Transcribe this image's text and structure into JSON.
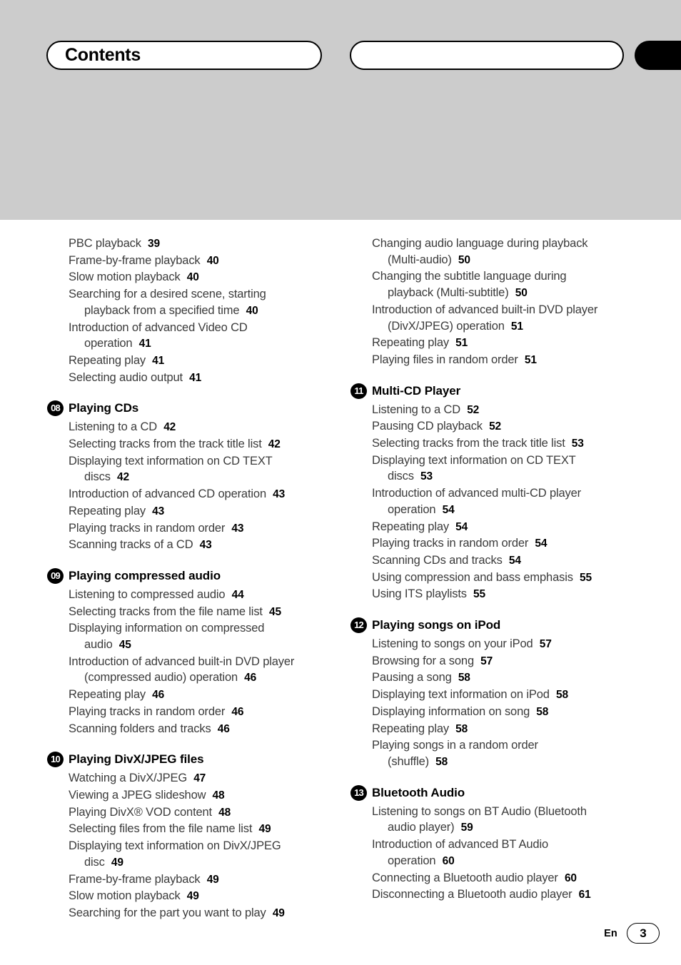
{
  "header": {
    "title": "Contents",
    "blank_pill_label": "",
    "black_tab_label": ""
  },
  "footer": {
    "language": "En",
    "page_number": "3"
  },
  "toc": {
    "left_column": [
      {
        "chapter": null,
        "entries": [
          {
            "title": "PBC playback",
            "cont": null,
            "page": "39"
          },
          {
            "title": "Frame-by-frame playback",
            "cont": null,
            "page": "40"
          },
          {
            "title": "Slow motion playback",
            "cont": null,
            "page": "40"
          },
          {
            "title": "Searching for a desired scene, starting",
            "cont": "playback from a specified time",
            "page": "40"
          },
          {
            "title": "Introduction of advanced Video CD",
            "cont": "operation",
            "page": "41"
          },
          {
            "title": "Repeating play",
            "cont": null,
            "page": "41"
          },
          {
            "title": "Selecting audio output",
            "cont": null,
            "page": "41"
          }
        ]
      },
      {
        "chapter": {
          "number": "08",
          "title": "Playing CDs"
        },
        "entries": [
          {
            "title": "Listening to a CD",
            "cont": null,
            "page": "42"
          },
          {
            "title": "Selecting tracks from the track title list",
            "cont": null,
            "page": "42"
          },
          {
            "title": "Displaying text information on CD TEXT",
            "cont": "discs",
            "page": "42"
          },
          {
            "title": "Introduction of advanced CD operation",
            "cont": null,
            "page": "43"
          },
          {
            "title": "Repeating play",
            "cont": null,
            "page": "43"
          },
          {
            "title": "Playing tracks in random order",
            "cont": null,
            "page": "43"
          },
          {
            "title": "Scanning tracks of a CD",
            "cont": null,
            "page": "43"
          }
        ]
      },
      {
        "chapter": {
          "number": "09",
          "title": "Playing compressed audio"
        },
        "entries": [
          {
            "title": "Listening to compressed audio",
            "cont": null,
            "page": "44"
          },
          {
            "title": "Selecting tracks from the file name list",
            "cont": null,
            "page": "45"
          },
          {
            "title": "Displaying information on compressed",
            "cont": "audio",
            "page": "45"
          },
          {
            "title": "Introduction of advanced built-in DVD player",
            "cont": "(compressed audio) operation",
            "page": "46"
          },
          {
            "title": "Repeating play",
            "cont": null,
            "page": "46"
          },
          {
            "title": "Playing tracks in random order",
            "cont": null,
            "page": "46"
          },
          {
            "title": "Scanning folders and tracks",
            "cont": null,
            "page": "46"
          }
        ]
      },
      {
        "chapter": {
          "number": "10",
          "title": "Playing DivX/JPEG files"
        },
        "entries": [
          {
            "title": "Watching a DivX/JPEG",
            "cont": null,
            "page": "47"
          },
          {
            "title": "Viewing a JPEG slideshow",
            "cont": null,
            "page": "48"
          },
          {
            "title": "Playing DivX® VOD content",
            "cont": null,
            "page": "48"
          },
          {
            "title": "Selecting files from the file name list",
            "cont": null,
            "page": "49"
          },
          {
            "title": "Displaying text information on DivX/JPEG",
            "cont": "disc",
            "page": "49"
          },
          {
            "title": "Frame-by-frame playback",
            "cont": null,
            "page": "49"
          },
          {
            "title": "Slow motion playback",
            "cont": null,
            "page": "49"
          },
          {
            "title": "Searching for the part you want to play",
            "cont": null,
            "page": "49"
          }
        ]
      }
    ],
    "right_column": [
      {
        "chapter": null,
        "entries": [
          {
            "title": "Changing audio language during playback",
            "cont": "(Multi-audio)",
            "page": "50"
          },
          {
            "title": "Changing the subtitle language during",
            "cont": "playback (Multi-subtitle)",
            "page": "50"
          },
          {
            "title": "Introduction of advanced built-in DVD player",
            "cont": "(DivX/JPEG) operation",
            "page": "51"
          },
          {
            "title": "Repeating play",
            "cont": null,
            "page": "51"
          },
          {
            "title": "Playing files in random order",
            "cont": null,
            "page": "51"
          }
        ]
      },
      {
        "chapter": {
          "number": "11",
          "title": "Multi-CD Player"
        },
        "entries": [
          {
            "title": "Listening to a CD",
            "cont": null,
            "page": "52"
          },
          {
            "title": "Pausing CD playback",
            "cont": null,
            "page": "52"
          },
          {
            "title": "Selecting tracks from the track title list",
            "cont": null,
            "page": "53"
          },
          {
            "title": "Displaying text information on CD TEXT",
            "cont": "discs",
            "page": "53"
          },
          {
            "title": "Introduction of advanced multi-CD player",
            "cont": "operation",
            "page": "54"
          },
          {
            "title": "Repeating play",
            "cont": null,
            "page": "54"
          },
          {
            "title": "Playing tracks in random order",
            "cont": null,
            "page": "54"
          },
          {
            "title": "Scanning CDs and tracks",
            "cont": null,
            "page": "54"
          },
          {
            "title": "Using compression and bass emphasis",
            "cont": null,
            "page": "55"
          },
          {
            "title": "Using ITS playlists",
            "cont": null,
            "page": "55"
          }
        ]
      },
      {
        "chapter": {
          "number": "12",
          "title": "Playing songs on iPod"
        },
        "entries": [
          {
            "title": "Listening to songs on your iPod",
            "cont": null,
            "page": "57"
          },
          {
            "title": "Browsing for a song",
            "cont": null,
            "page": "57"
          },
          {
            "title": "Pausing a song",
            "cont": null,
            "page": "58"
          },
          {
            "title": "Displaying text information on iPod",
            "cont": null,
            "page": "58"
          },
          {
            "title": "Displaying information on song",
            "cont": null,
            "page": "58"
          },
          {
            "title": "Repeating play",
            "cont": null,
            "page": "58"
          },
          {
            "title": "Playing songs in a random order",
            "cont": "(shuffle)",
            "page": "58"
          }
        ]
      },
      {
        "chapter": {
          "number": "13",
          "title": "Bluetooth Audio"
        },
        "entries": [
          {
            "title": "Listening to songs on BT Audio (Bluetooth",
            "cont": "audio player)",
            "page": "59"
          },
          {
            "title": "Introduction of advanced BT Audio",
            "cont": "operation",
            "page": "60"
          },
          {
            "title": "Connecting a Bluetooth audio player",
            "cont": null,
            "page": "60"
          },
          {
            "title": "Disconnecting a Bluetooth audio player",
            "cont": null,
            "page": "61"
          }
        ]
      }
    ]
  }
}
